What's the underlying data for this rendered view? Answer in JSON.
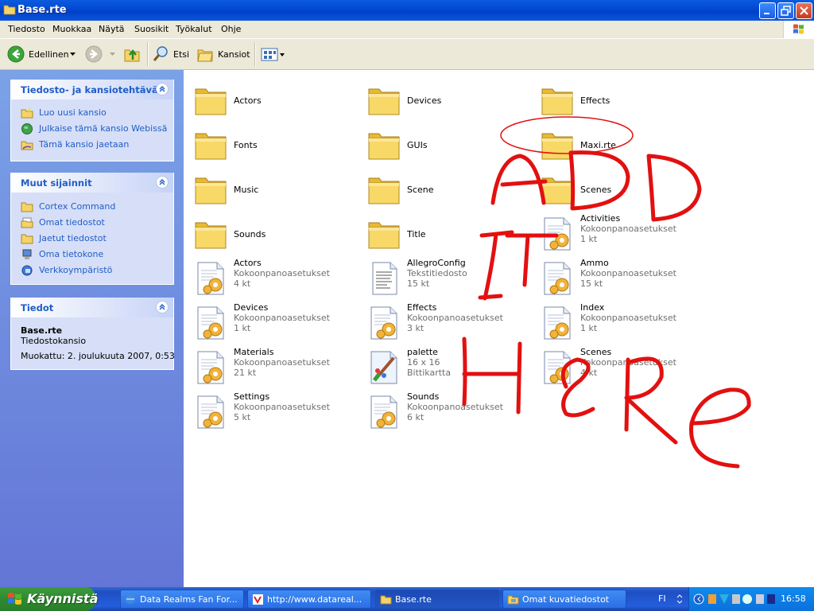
{
  "window": {
    "title": "Base.rte"
  },
  "menu": [
    "Tiedosto",
    "Muokkaa",
    "Näytä",
    "Suosikit",
    "Työkalut",
    "Ohje"
  ],
  "toolbar": {
    "back_label": "Edellinen",
    "search_label": "Etsi",
    "folders_label": "Kansiot"
  },
  "tasks_panel": {
    "file_tasks": {
      "title": "Tiedosto- ja kansiotehtävät",
      "items": [
        "Luo uusi kansio",
        "Julkaise tämä kansio Webissä",
        "Tämä kansio jaetaan"
      ]
    },
    "other_places": {
      "title": "Muut sijainnit",
      "items": [
        "Cortex Command",
        "Omat tiedostot",
        "Jaetut tiedostot",
        "Oma tietokone",
        "Verkkoympäristö"
      ]
    },
    "details": {
      "title": "Tiedot",
      "name": "Base.rte",
      "type": "Tiedostokansio",
      "modified": "Muokattu: 2. joulukuuta 2007, 0:53"
    }
  },
  "items": [
    {
      "name": "Actors",
      "kind": "folder"
    },
    {
      "name": "Devices",
      "kind": "folder"
    },
    {
      "name": "Effects",
      "kind": "folder"
    },
    {
      "name": "Fonts",
      "kind": "folder"
    },
    {
      "name": "GUIs",
      "kind": "folder"
    },
    {
      "name": "Maxi.rte",
      "kind": "folder"
    },
    {
      "name": "Music",
      "kind": "folder"
    },
    {
      "name": "Scene",
      "kind": "folder"
    },
    {
      "name": "Scenes",
      "kind": "folder"
    },
    {
      "name": "Sounds",
      "kind": "folder"
    },
    {
      "name": "Title",
      "kind": "folder"
    },
    {
      "name": "Activities",
      "kind": "ini",
      "type": "Kokoonpanoasetukset",
      "size": "1 kt"
    },
    {
      "name": "Actors",
      "kind": "ini",
      "type": "Kokoonpanoasetukset",
      "size": "4 kt"
    },
    {
      "name": "AllegroConfig",
      "kind": "txt",
      "type": "Tekstitiedosto",
      "size": "15 kt"
    },
    {
      "name": "Ammo",
      "kind": "ini",
      "type": "Kokoonpanoasetukset",
      "size": "15 kt"
    },
    {
      "name": "Devices",
      "kind": "ini",
      "type": "Kokoonpanoasetukset",
      "size": "1 kt"
    },
    {
      "name": "Effects",
      "kind": "ini",
      "type": "Kokoonpanoasetukset",
      "size": "3 kt"
    },
    {
      "name": "Index",
      "kind": "ini",
      "type": "Kokoonpanoasetukset",
      "size": "1 kt"
    },
    {
      "name": "Materials",
      "kind": "ini",
      "type": "Kokoonpanoasetukset",
      "size": "21 kt"
    },
    {
      "name": "palette",
      "kind": "bmp",
      "type": "16 x 16",
      "size": "Bittikartta"
    },
    {
      "name": "Scenes",
      "kind": "ini",
      "type": "Kokoonpanoasetukset",
      "size": "4 kt"
    },
    {
      "name": "Settings",
      "kind": "ini",
      "type": "Kokoonpanoasetukset",
      "size": "5 kt"
    },
    {
      "name": "Sounds",
      "kind": "ini",
      "type": "Kokoonpanoasetukset",
      "size": "6 kt"
    }
  ],
  "taskbar": {
    "start_label": "Käynnistä",
    "tasks": [
      "Data Realms Fan For...",
      "http://www.datareal...",
      "Base.rte",
      "Omat kuvatiedostot"
    ],
    "active_task": "Base.rte",
    "language": "FI",
    "clock": "16:58"
  },
  "colors": {
    "annotation": "#e31010",
    "link": "#215dc6",
    "taskbar": "#245edb"
  }
}
